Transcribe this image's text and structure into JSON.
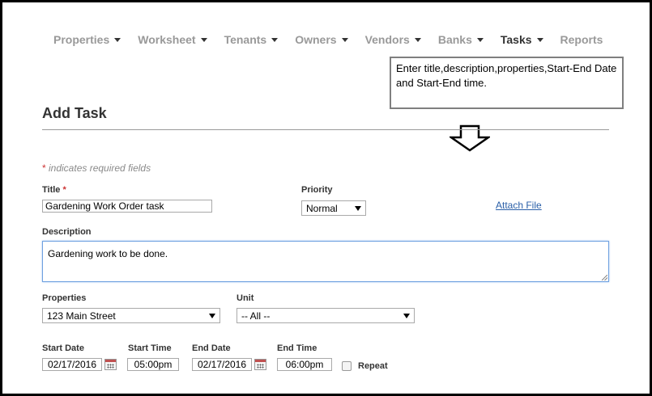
{
  "nav": {
    "items": [
      {
        "label": "Properties",
        "has_caret": true,
        "active": false
      },
      {
        "label": "Worksheet",
        "has_caret": true,
        "active": false
      },
      {
        "label": "Tenants",
        "has_caret": true,
        "active": false
      },
      {
        "label": "Owners",
        "has_caret": true,
        "active": false
      },
      {
        "label": "Vendors",
        "has_caret": true,
        "active": false
      },
      {
        "label": "Banks",
        "has_caret": true,
        "active": false
      },
      {
        "label": "Tasks",
        "has_caret": true,
        "active": true
      },
      {
        "label": "Reports",
        "has_caret": false,
        "active": false
      }
    ]
  },
  "callout": {
    "text": "Enter title,description,properties,Start-End Date and Start-End time.",
    "arrow_icon": "down-arrow-outline-icon"
  },
  "page": {
    "title": "Add Task",
    "required_star": "*",
    "required_note": " indicates required fields"
  },
  "form": {
    "title_label": "Title",
    "title_required": "*",
    "title_value": "Gardening Work Order task",
    "priority_label": "Priority",
    "priority_value": "Normal",
    "attach_file": "Attach File",
    "description_label": "Description",
    "description_value": "Gardening work to be done.",
    "properties_label": "Properties",
    "properties_value": "123 Main Street",
    "unit_label": "Unit",
    "unit_value": "-- All --",
    "start_date_label": "Start Date",
    "start_date_value": "02/17/2016",
    "start_time_label": "Start Time",
    "start_time_value": "05:00pm",
    "end_date_label": "End Date",
    "end_date_value": "02/17/2016",
    "end_time_label": "End Time",
    "end_time_value": "06:00pm",
    "repeat_label": "Repeat",
    "repeat_checked": false
  },
  "colors": {
    "link": "#2a5fa8",
    "required": "#cc3333",
    "nav_inactive": "#999999",
    "nav_active": "#333333",
    "focus_border": "#6fa1e0"
  }
}
